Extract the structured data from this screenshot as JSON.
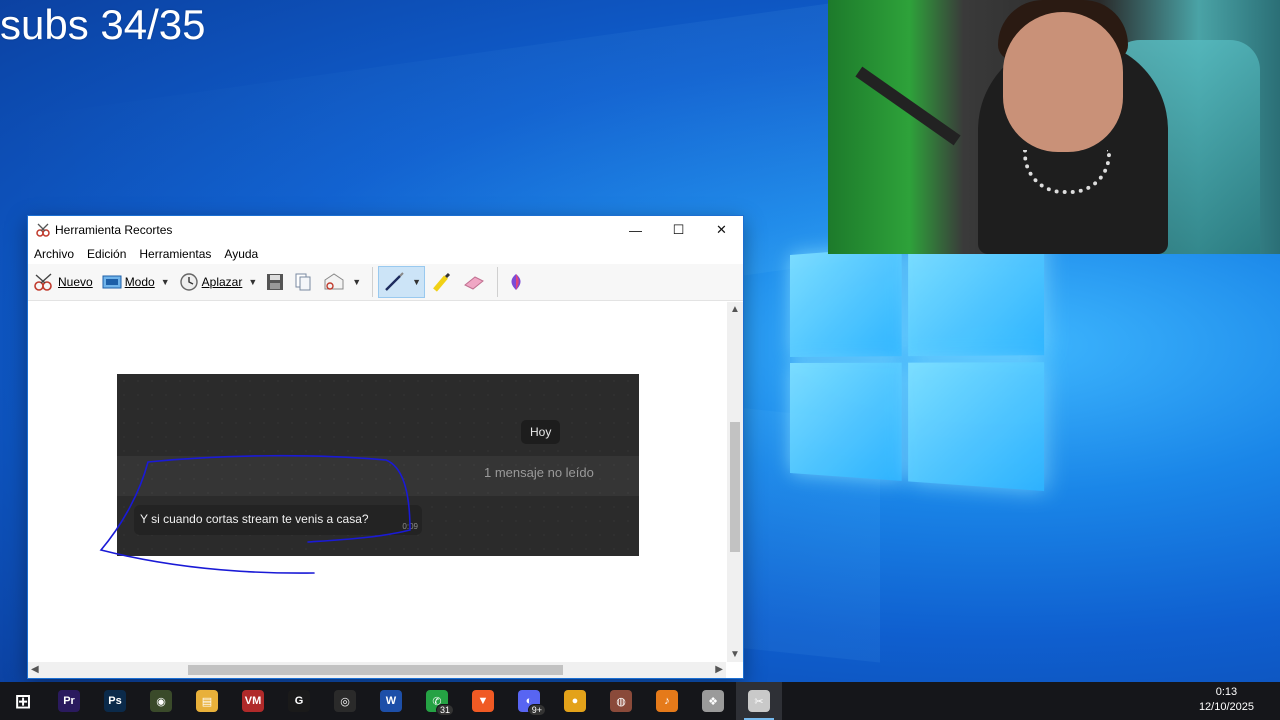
{
  "overlay": {
    "subs_text": "subs 34/35"
  },
  "snipping_tool": {
    "title": "Herramienta Recortes",
    "window_controls": {
      "minimize": "—",
      "maximize": "☐",
      "close": "✕"
    },
    "menu": [
      "Archivo",
      "Edición",
      "Herramientas",
      "Ayuda"
    ],
    "toolbar": {
      "new_label": "Nuevo",
      "mode_label": "Modo",
      "delay_label": "Aplazar",
      "active_tool": "pen"
    },
    "capture": {
      "day_badge": "Hoy",
      "unread_text": "1 mensaje no leído",
      "message_text": "Y si cuando cortas stream te venis a casa?",
      "message_time": "0:09",
      "ink_color": "#1a1ad6"
    }
  },
  "taskbar": {
    "icons": [
      {
        "name": "start-icon",
        "glyph": "⊞",
        "color": "#ffffff"
      },
      {
        "name": "premiere-icon",
        "glyph": "Pr",
        "color": "#2a1a5e"
      },
      {
        "name": "photoshop-icon",
        "glyph": "Ps",
        "color": "#0b2a4a"
      },
      {
        "name": "app-icon",
        "glyph": "◉",
        "color": "#3a4a2a"
      },
      {
        "name": "file-explorer-icon",
        "glyph": "▤",
        "color": "#e8b03a"
      },
      {
        "name": "voicemeeter-icon",
        "glyph": "VM",
        "color": "#b02a2a"
      },
      {
        "name": "logitech-icon",
        "glyph": "G",
        "color": "#1a1a1a"
      },
      {
        "name": "obs-icon",
        "glyph": "◎",
        "color": "#2a2a2a"
      },
      {
        "name": "word-icon",
        "glyph": "W",
        "color": "#1d4fa8"
      },
      {
        "name": "whatsapp-icon",
        "glyph": "✆",
        "color": "#25a244",
        "badge": "31"
      },
      {
        "name": "brave-icon",
        "glyph": "▼",
        "color": "#f05a24"
      },
      {
        "name": "discord-icon",
        "glyph": "◐",
        "color": "#5865f2",
        "badge": "9+"
      },
      {
        "name": "chrome-icon",
        "glyph": "●",
        "color": "#e3a21a"
      },
      {
        "name": "app2-icon",
        "glyph": "◍",
        "color": "#8a4a3a"
      },
      {
        "name": "fl-studio-icon",
        "glyph": "♪",
        "color": "#e57a1a"
      },
      {
        "name": "app3-icon",
        "glyph": "❖",
        "color": "#9a9a9a"
      },
      {
        "name": "snipping-tool-icon",
        "glyph": "✂",
        "color": "#c9c9c9",
        "active": true
      }
    ],
    "clock_time": "0:13",
    "clock_date": "12/10/2025"
  }
}
